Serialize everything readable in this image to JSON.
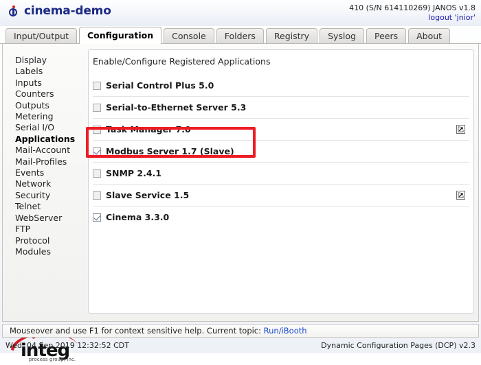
{
  "header": {
    "icon": "info-circle-icon",
    "title": "cinema-demo",
    "device_info": "410 (S/N 614110269) JANOS v1.8",
    "logout_label": "logout 'jnior'"
  },
  "tabs": [
    {
      "label": "Input/Output",
      "active": false
    },
    {
      "label": "Configuration",
      "active": true
    },
    {
      "label": "Console",
      "active": false
    },
    {
      "label": "Folders",
      "active": false
    },
    {
      "label": "Registry",
      "active": false
    },
    {
      "label": "Syslog",
      "active": false
    },
    {
      "label": "Peers",
      "active": false
    },
    {
      "label": "About",
      "active": false
    }
  ],
  "sidebar": {
    "items": [
      {
        "label": "Display",
        "active": false
      },
      {
        "label": "Labels",
        "active": false
      },
      {
        "label": "Inputs",
        "active": false
      },
      {
        "label": "Counters",
        "active": false
      },
      {
        "label": "Outputs",
        "active": false
      },
      {
        "label": "Metering",
        "active": false
      },
      {
        "label": "Serial I/O",
        "active": false
      },
      {
        "label": "Applications",
        "active": true
      },
      {
        "label": "Mail-Account",
        "active": false
      },
      {
        "label": "Mail-Profiles",
        "active": false
      },
      {
        "label": "Events",
        "active": false
      },
      {
        "label": "Network",
        "active": false
      },
      {
        "label": "Security",
        "active": false
      },
      {
        "label": "Telnet",
        "active": false
      },
      {
        "label": "WebServer",
        "active": false
      },
      {
        "label": "FTP",
        "active": false
      },
      {
        "label": "Protocol",
        "active": false
      },
      {
        "label": "Modules",
        "active": false
      }
    ],
    "logo": {
      "word": "integ",
      "subtitle": "process group, inc.",
      "accent_color": "#cf2027"
    }
  },
  "panel": {
    "title": "Enable/Configure Registered Applications",
    "applications": [
      {
        "name": "Serial Control Plus 5.0",
        "checked": false,
        "has_config_link": false
      },
      {
        "name": "Serial-to-Ethernet Server 5.3",
        "checked": false,
        "has_config_link": false
      },
      {
        "name": "Task Manager 7.0",
        "checked": false,
        "has_config_link": true
      },
      {
        "name": "Modbus Server 1.7 (Slave)",
        "checked": true,
        "has_config_link": false
      },
      {
        "name": "SNMP 2.4.1",
        "checked": false,
        "has_config_link": false
      },
      {
        "name": "Slave Service 1.5",
        "checked": false,
        "has_config_link": true
      },
      {
        "name": "Cinema 3.3.0",
        "checked": true,
        "has_config_link": false
      }
    ]
  },
  "annotation": {
    "target": "Modbus Server 1.7 (Slave)",
    "color": "#ee1c25"
  },
  "helpbar": {
    "text": "Mouseover and use F1 for context sensitive help. Current topic:",
    "topic_link": "Run/iBooth"
  },
  "statusbar": {
    "timestamp": "Wed, 04 Sep 2019 12:32:52 CDT",
    "version": "Dynamic Configuration Pages (DCP) v2.3"
  }
}
